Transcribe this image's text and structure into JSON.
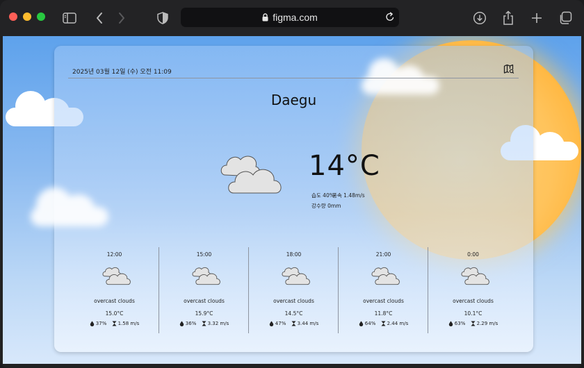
{
  "browser": {
    "url": "figma.com",
    "icons": [
      "sidebar-icon",
      "back-icon",
      "forward-icon",
      "shield-icon",
      "lock-icon",
      "reload-icon",
      "download-icon",
      "share-icon",
      "new-tab-icon",
      "tabs-icon"
    ]
  },
  "weather": {
    "datetime": "2025년 03월 12일 (수) 오전 11:09",
    "city": "Daegu",
    "temperature": "14°C",
    "humidity": "습도 40%",
    "wind": "풍속 1.48m/s",
    "precipitation": "강수량 0mm",
    "condition_icon": "overcast-clouds-icon",
    "forecast": [
      {
        "time": "12:00",
        "desc": "overcast clouds",
        "temp": "15.0°C",
        "humidity": "37%",
        "wind": "1.58 m/s"
      },
      {
        "time": "15:00",
        "desc": "overcast clouds",
        "temp": "15.9°C",
        "humidity": "36%",
        "wind": "3.32 m/s"
      },
      {
        "time": "18:00",
        "desc": "overcast clouds",
        "temp": "14.5°C",
        "humidity": "47%",
        "wind": "3.44 m/s"
      },
      {
        "time": "21:00",
        "desc": "overcast clouds",
        "temp": "11.8°C",
        "humidity": "64%",
        "wind": "2.44 m/s"
      },
      {
        "time": "0:00",
        "desc": "overcast clouds",
        "temp": "10.1°C",
        "humidity": "63%",
        "wind": "2.29 m/s"
      }
    ]
  },
  "colors": {
    "sky_top": "#5ea2ec",
    "sun": "#ffc35b",
    "cloud": "#e3e3e3"
  }
}
